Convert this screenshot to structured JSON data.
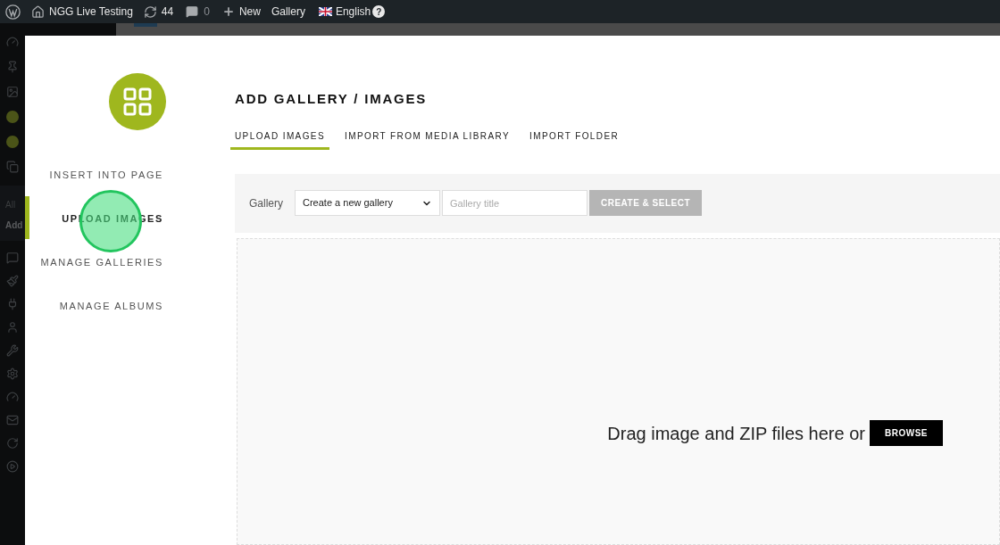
{
  "admin_bar": {
    "site": "NGG Live Testing",
    "updates": "44",
    "comments": "0",
    "new": "New",
    "gallery": "Gallery",
    "language": "English",
    "help": "?"
  },
  "admin_menu": {
    "submenu": [
      "All",
      "Add"
    ]
  },
  "modal": {
    "nav": [
      {
        "label": "INSERT INTO PAGE",
        "selected": false
      },
      {
        "label": "UPLOAD IMAGES",
        "selected": true
      },
      {
        "label": "MANAGE GALLERIES",
        "selected": false
      },
      {
        "label": "MANAGE ALBUMS",
        "selected": false
      }
    ],
    "title": "ADD GALLERY / IMAGES",
    "tabs": [
      {
        "label": "UPLOAD IMAGES",
        "selected": true
      },
      {
        "label": "IMPORT FROM MEDIA LIBRARY",
        "selected": false
      },
      {
        "label": "IMPORT FOLDER",
        "selected": false
      }
    ],
    "gallery_label": "Gallery",
    "gallery_select": "Create a new gallery",
    "title_field": {
      "placeholder": "Gallery title"
    },
    "create_button": "CREATE & SELECT",
    "dropzone": {
      "text": "Drag image and ZIP files here or",
      "browse": "BROWSE"
    }
  }
}
